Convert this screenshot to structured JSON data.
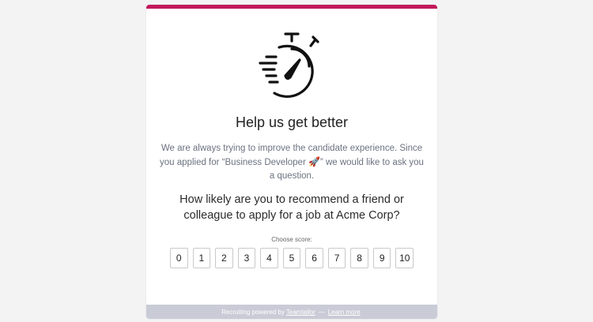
{
  "colors": {
    "accent": "#c2185b",
    "footer_bg": "#c9ccd6",
    "text_muted": "#6b7280"
  },
  "hero": {
    "icon": "stopwatch-icon"
  },
  "title": "Help us get better",
  "intro": {
    "before": "We are always trying to improve the candidate experience. Since you applied for “Business Developer ",
    "emoji": "🚀",
    "after": "” we would like to ask you a question."
  },
  "question": "How likely are you to recommend a friend or colleague to apply for a job at Acme Corp?",
  "choose_label": "Choose score:",
  "scores": [
    "0",
    "1",
    "2",
    "3",
    "4",
    "5",
    "6",
    "7",
    "8",
    "9",
    "10"
  ],
  "footer": {
    "powered_by": "Recruiting powered by",
    "brand_link": "Teamtailor",
    "separator": "—",
    "learn_more": "Learn more"
  }
}
